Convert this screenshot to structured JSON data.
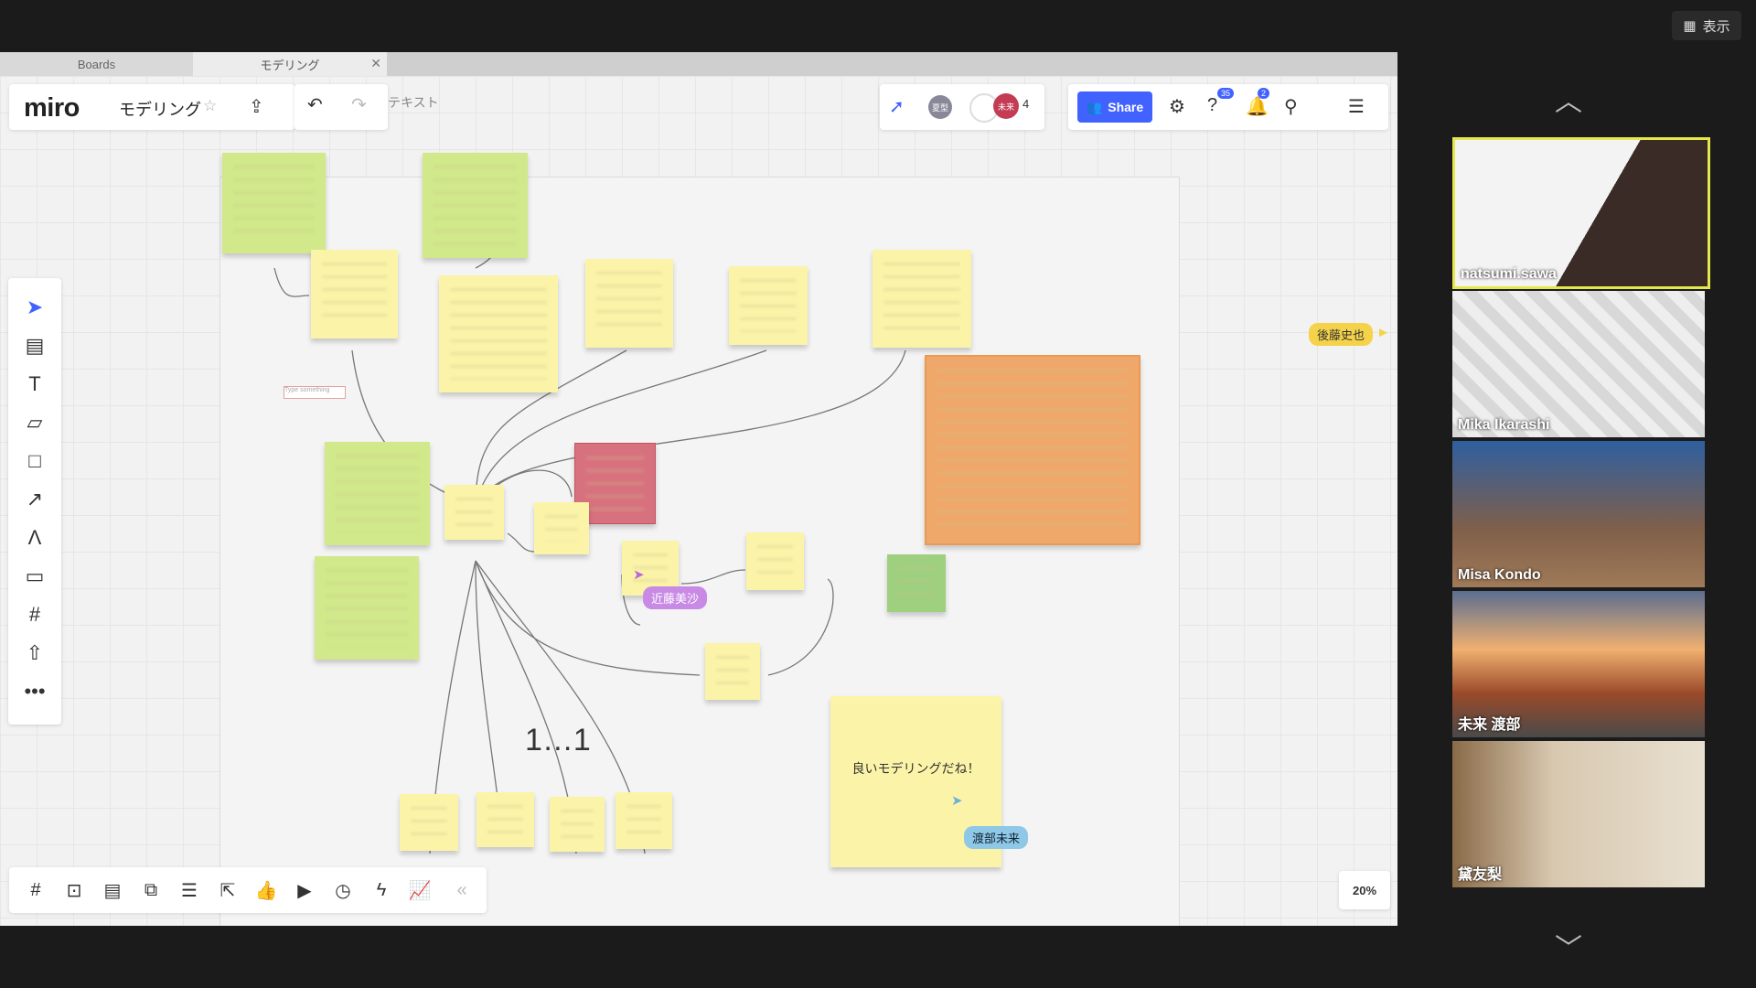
{
  "view_button": {
    "label": "表示"
  },
  "tabs": [
    {
      "label": "Boards"
    },
    {
      "label": "モデリング"
    }
  ],
  "header": {
    "logo": "miro",
    "board_name": "モデリング",
    "hidden_text": "テキスト",
    "collaborator_count": "4",
    "collaborator_badge": "未来",
    "avatar_badge": "夏型",
    "share_label": "Share",
    "help_badge": "35",
    "notif_badge": "2"
  },
  "canvas": {
    "label_1to1": "1…1",
    "big_note_text": "良いモデリングだね！",
    "placeholder_text": "Type something"
  },
  "cursors": [
    {
      "label": "近藤美沙",
      "color": "#c88ae5"
    },
    {
      "label": "渡部未来",
      "color": "#8ec8e6"
    },
    {
      "label": "後藤史也",
      "color": "#f4d34a"
    }
  ],
  "zoom": "20%",
  "participants": [
    {
      "name": "natsumi.sawa"
    },
    {
      "name": "Mika Ikarashi"
    },
    {
      "name": "Misa Kondo"
    },
    {
      "name": "未来 渡部"
    },
    {
      "name": "黛友梨"
    }
  ],
  "colors": {
    "accent": "#4262ff",
    "sticky_yellow": "#fbf4a8",
    "sticky_green": "#d1e98a",
    "sticky_orange": "#f0a86a",
    "sticky_red": "#d8717e"
  }
}
